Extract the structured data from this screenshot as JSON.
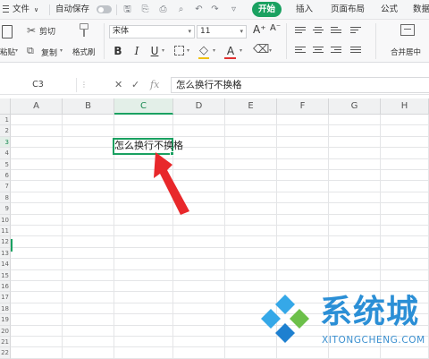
{
  "menubar": {
    "file_label": "文件",
    "autosave_label": "自动保存",
    "tabs": [
      "开始",
      "插入",
      "页面布局",
      "公式",
      "数据"
    ],
    "active_tab": "开始",
    "accent_color": "#1aa161"
  },
  "ribbon": {
    "paste_label": "粘贴",
    "cut_label": "剪切",
    "copy_label": "复制",
    "format_painter_label": "格式刷",
    "font_name": "宋体",
    "font_size": "11",
    "bold": "B",
    "italic": "I",
    "underline": "U",
    "font_color_glyph": "A",
    "grow_font": "A⁺",
    "shrink_font": "A⁻",
    "merge_center_label": "合并居中"
  },
  "formula_bar": {
    "cell_ref": "C3",
    "cancel_glyph": "✕",
    "confirm_glyph": "✓",
    "fx_glyph": "fx",
    "content": "怎么换行不换格"
  },
  "grid": {
    "columns": [
      "A",
      "B",
      "C",
      "D",
      "E",
      "F",
      "G",
      "H"
    ],
    "rows": [
      "1",
      "2",
      "3",
      "4",
      "5",
      "6",
      "7",
      "8",
      "9",
      "10",
      "11",
      "12",
      "13",
      "14",
      "15",
      "16",
      "17",
      "18",
      "19",
      "20",
      "21",
      "22"
    ],
    "active_column": "C",
    "active_row": "3",
    "active_cell_text": "怎么换行不换格"
  },
  "watermark": {
    "title": "系统城",
    "subtitle": "XITONGCHENG.COM",
    "color": "#2b8fd6"
  }
}
